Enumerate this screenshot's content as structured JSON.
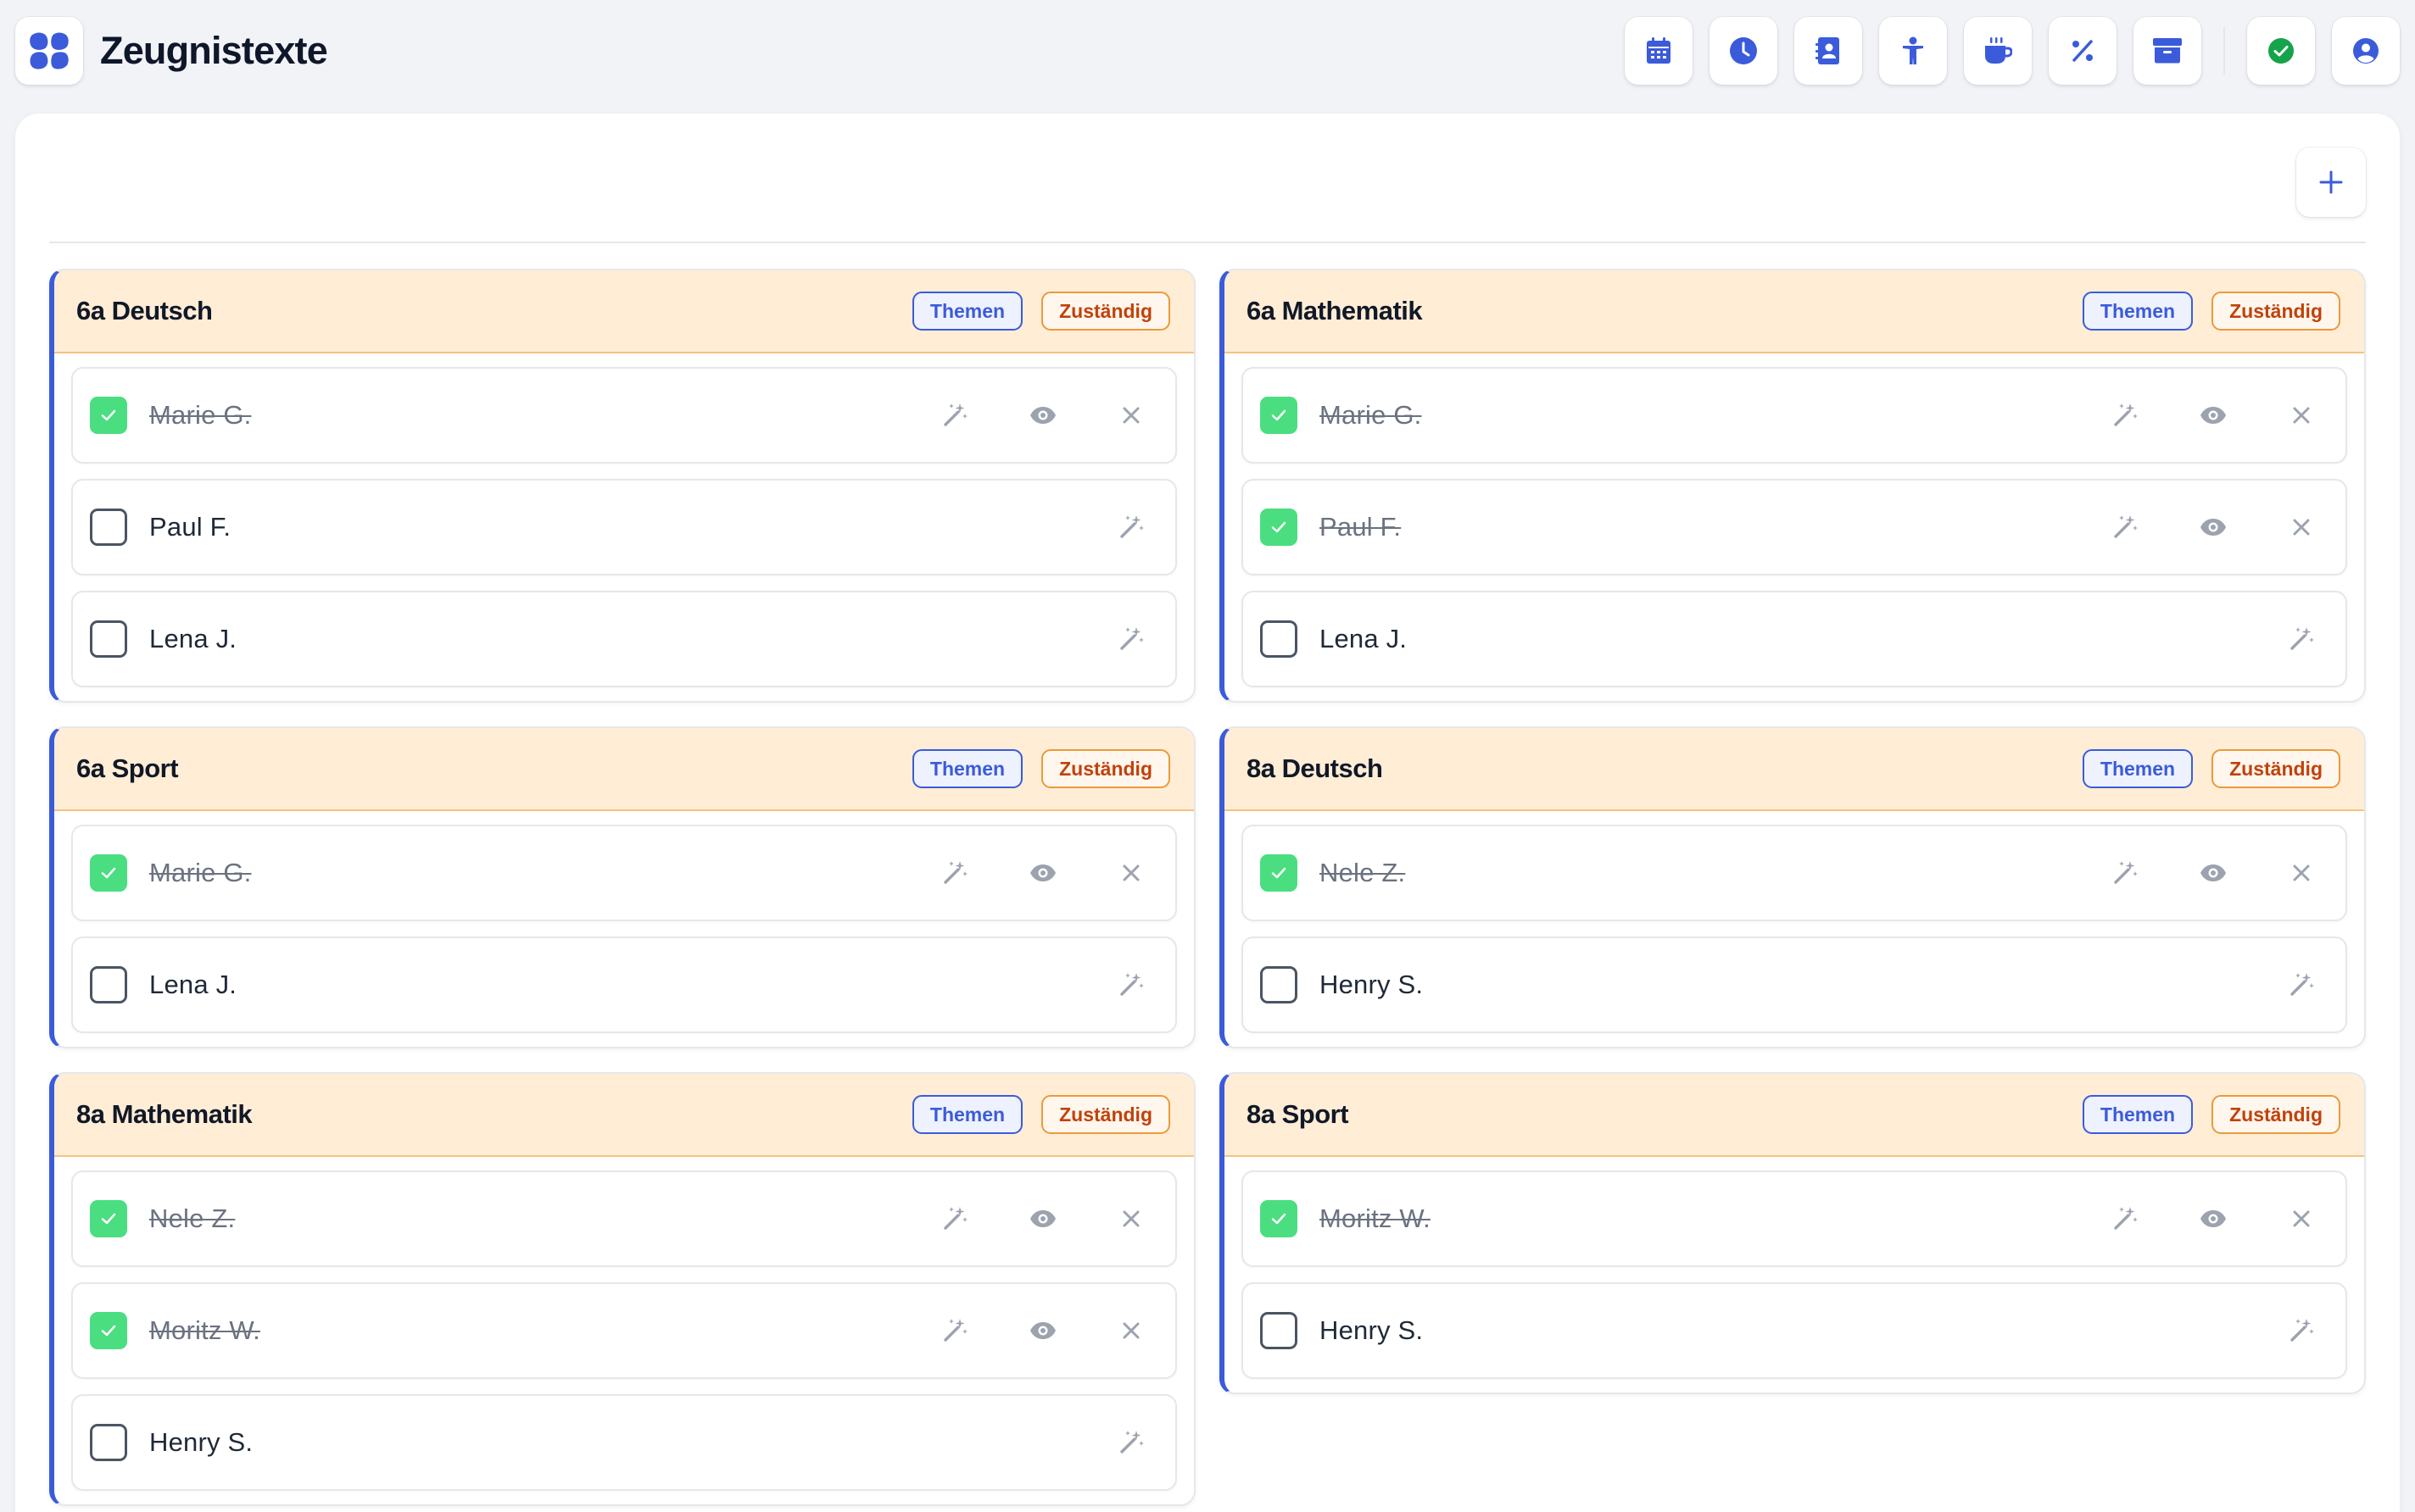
{
  "header": {
    "title": "Zeugnistexte",
    "toolbar": [
      {
        "icon": "calendar-icon"
      },
      {
        "icon": "clock-icon"
      },
      {
        "icon": "contact-book-icon"
      },
      {
        "icon": "person-icon"
      },
      {
        "icon": "coffee-icon"
      },
      {
        "icon": "percent-icon"
      },
      {
        "icon": "archive-icon"
      },
      {
        "icon": "check-circle-icon"
      },
      {
        "icon": "user-circle-icon"
      }
    ]
  },
  "colors": {
    "accent": "#3b5bdb",
    "card_header_bg": "#ffedd6",
    "badge_zustaendig": "#c2410c",
    "done_green": "#4ade80",
    "status_green": "#16a34a"
  },
  "badges": {
    "themen": "Themen",
    "zustaendig": "Zuständig"
  },
  "courses": [
    {
      "title": "6a Deutsch",
      "students": [
        {
          "name": "Marie G.",
          "done": true
        },
        {
          "name": "Paul F.",
          "done": false
        },
        {
          "name": "Lena J.",
          "done": false
        }
      ]
    },
    {
      "title": "6a Mathematik",
      "students": [
        {
          "name": "Marie G.",
          "done": true
        },
        {
          "name": "Paul F.",
          "done": true
        },
        {
          "name": "Lena J.",
          "done": false
        }
      ]
    },
    {
      "title": "6a Sport",
      "students": [
        {
          "name": "Marie G.",
          "done": true
        },
        {
          "name": "Lena J.",
          "done": false
        }
      ]
    },
    {
      "title": "8a Deutsch",
      "students": [
        {
          "name": "Nele Z.",
          "done": true
        },
        {
          "name": "Henry S.",
          "done": false
        }
      ]
    },
    {
      "title": "8a Mathematik",
      "students": [
        {
          "name": "Nele Z.",
          "done": true
        },
        {
          "name": "Moritz W.",
          "done": true
        },
        {
          "name": "Henry S.",
          "done": false
        }
      ]
    },
    {
      "title": "8a Sport",
      "students": [
        {
          "name": "Moritz W.",
          "done": true
        },
        {
          "name": "Henry S.",
          "done": false
        }
      ]
    }
  ]
}
